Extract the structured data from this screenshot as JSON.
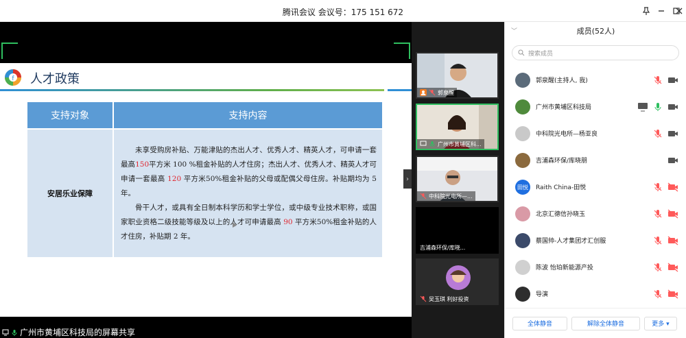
{
  "window": {
    "title": "腾讯会议  会议号：175 151 672"
  },
  "slide": {
    "title": "人才政策",
    "table": {
      "header": [
        "支持对象",
        "支持内容"
      ],
      "category": "安居乐业保障",
      "p1_a": "未享受购房补贴、万能津贴的杰出人才、优秀人才、精英人才，可申请一套最高",
      "p1_v1": "150",
      "p1_b": "平方米 100 %租金补贴的人才住房；杰出人才、优秀人才、精英人才可申请一套最高 ",
      "p1_v2": "120",
      "p1_c": " 平方米50%租金补贴的父母或配偶父母住房。补贴期均为 5 年。",
      "p2_a": "骨干人才，或具有全日制本科学历和学士学位，或中级专业技术职称，或国家职业资格二级技能等级及以上的人才可申请最高 ",
      "p2_v": "90",
      "p2_b": " 平方米50%租金补贴的人才住房，补贴期 2 年。"
    }
  },
  "share_label": "广州市黄埔区科技局的屏幕共享",
  "video_tiles": [
    {
      "name": "郭泉醒"
    },
    {
      "name": "广州市黄埔区科..."
    },
    {
      "name": "中科院光电所—..."
    },
    {
      "name": "吉浦森环保/库晓..."
    },
    {
      "name": "吴玉琪 利好投资"
    }
  ],
  "panel": {
    "title": "成员(52人)",
    "search_placeholder": "搜索成员",
    "members": [
      {
        "name": "郭泉醒(主持人, 我)",
        "avatar_color": "#5b6b7a"
      },
      {
        "name": "广州市黄埔区科技局",
        "avatar_color": "#4f8a3c"
      },
      {
        "name": "中科院光电所—杨亚良",
        "avatar_color": "#c9c9c9"
      },
      {
        "name": "吉浦森环保/库晓朋",
        "avatar_color": "#8b6a3e"
      },
      {
        "name": "Raith China-田悦",
        "avatar_color": "#1f6fe0",
        "avatar_text": "田悦"
      },
      {
        "name": "北京汇德信孙晓玉",
        "avatar_color": "#d99aa6"
      },
      {
        "name": "蔡国帅-人才集团才汇创服",
        "avatar_color": "#3b4a6a"
      },
      {
        "name": "陈波 怡珀新能源产投",
        "avatar_color": "#d0d0d0"
      },
      {
        "name": "导演",
        "avatar_color": "#2e2e2e"
      }
    ],
    "buttons": {
      "mute_all": "全体静音",
      "unmute_all": "解除全体静音",
      "more": "更多 ▾"
    }
  }
}
